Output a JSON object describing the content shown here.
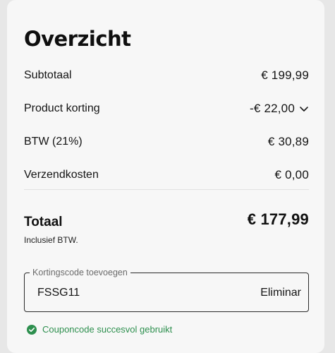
{
  "summary": {
    "title": "Overzicht",
    "rows": [
      {
        "label": "Subtotaal",
        "value": "€ 199,99"
      },
      {
        "label": "Product korting",
        "value": "-€ 22,00"
      },
      {
        "label": "BTW (21%)",
        "value": "€ 30,89"
      },
      {
        "label": "Verzendkosten",
        "value": "€ 0,00"
      }
    ],
    "total": {
      "label": "Totaal",
      "value": "€ 177,99",
      "sub": "Inclusief BTW."
    }
  },
  "coupon": {
    "legend": "Kortingscode toevoegen",
    "value": "FSSG11",
    "remove_label": "Eliminar",
    "success_message": "Couponcode succesvol gebruikt"
  },
  "colors": {
    "success": "#2d8f4e",
    "card": "#f7f7f7",
    "background": "#e7e7e7"
  },
  "icons": {
    "discount_toggle": "chevron-down-icon",
    "success": "check-circle-icon"
  }
}
